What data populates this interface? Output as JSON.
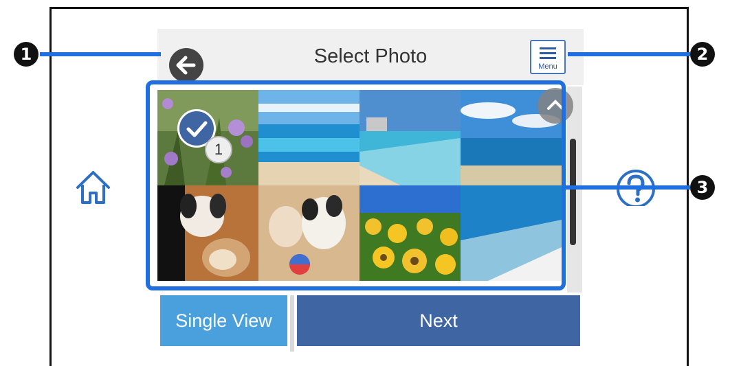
{
  "screen": {
    "title": "Select Photo",
    "menu_label": "Menu"
  },
  "grid": {
    "photos": [
      {
        "subject": "purple flowers",
        "selected": true,
        "order": "1"
      },
      {
        "subject": "beach waves",
        "selected": false
      },
      {
        "subject": "beach shore",
        "selected": false
      },
      {
        "subject": "ocean sky",
        "selected": false
      },
      {
        "subject": "dog",
        "selected": false
      },
      {
        "subject": "two dogs with ball",
        "selected": false
      },
      {
        "subject": "sunflowers",
        "selected": false
      },
      {
        "subject": "beach foam",
        "selected": false
      }
    ]
  },
  "buttons": {
    "single_view": "Single View",
    "next": "Next"
  },
  "callouts": {
    "one": "1",
    "two": "2",
    "three": "3"
  },
  "colors": {
    "accent": "#1f6fe0",
    "next_bg": "#3f65a3",
    "single_view_bg": "#4a9fdd"
  }
}
